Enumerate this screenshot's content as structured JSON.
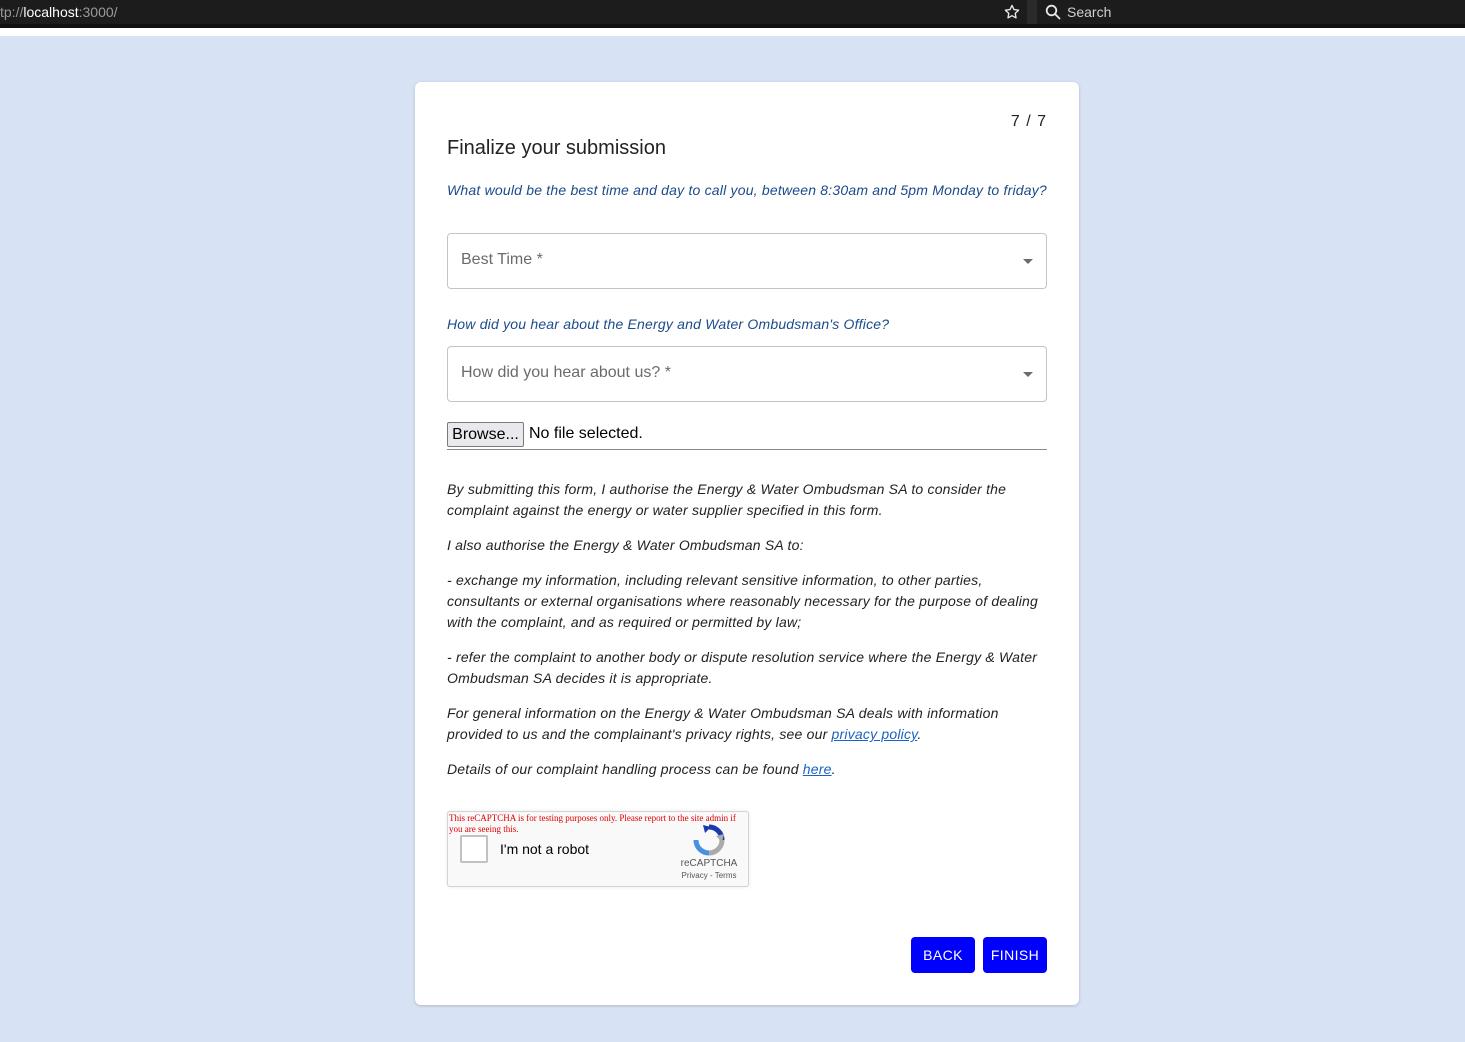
{
  "browser": {
    "url_prefix": "tp://",
    "url_host": "localhost",
    "url_rest": ":3000/",
    "search_placeholder": "Search"
  },
  "form": {
    "step": "7 / 7",
    "title": "Finalize your submission",
    "q_best_time": "What would be the best time and day to call you, between 8:30am and 5pm Monday to friday?",
    "best_time_label": "Best Time *",
    "q_hear_about": "How did you hear about the Energy and Water Ombudsman's Office?",
    "hear_about_label": "How did you hear about us? *",
    "browse_label": "Browse...",
    "file_status": "No file selected.",
    "consent_1": "By submitting this form, I authorise the Energy & Water Ombudsman SA to consider the complaint against the energy or water supplier specified in this form.",
    "consent_2": "I also authorise the Energy & Water Ombudsman SA to:",
    "consent_3": "- exchange my information, including relevant sensitive information, to other parties, consultants or external organisations where reasonably necessary for the purpose of dealing with the complaint, and as required or permitted by law;",
    "consent_4": "- refer the complaint to another body or dispute resolution service where the Energy & Water Ombudsman SA decides it is appropriate.",
    "privacy_text": "For general information on the Energy & Water Ombudsman SA deals with information provided to us and the complainant's privacy rights, see our ",
    "privacy_link": "privacy policy",
    "privacy_end": ".",
    "process_text": "Details of our complaint handling process can be found ",
    "process_link": "here",
    "process_end": ".",
    "back_label": "BACK",
    "finish_label": "FINISH"
  },
  "recaptcha": {
    "warning": "This reCAPTCHA is for testing purposes only. Please report to the site admin if you are seeing this.",
    "label": "I'm not a robot",
    "brand": "reCAPTCHA",
    "links": "Privacy - Terms"
  },
  "colors": {
    "page_bg": "#d7e2f4",
    "question_text": "#1b4b8a",
    "button_bg": "#0000ff",
    "link": "#1a62c0",
    "warning": "#e00000"
  },
  "icons": {
    "bookmark": "star-icon",
    "search": "search-icon",
    "dropdown": "chevron-down-icon",
    "recaptcha": "recaptcha-logo-icon"
  }
}
